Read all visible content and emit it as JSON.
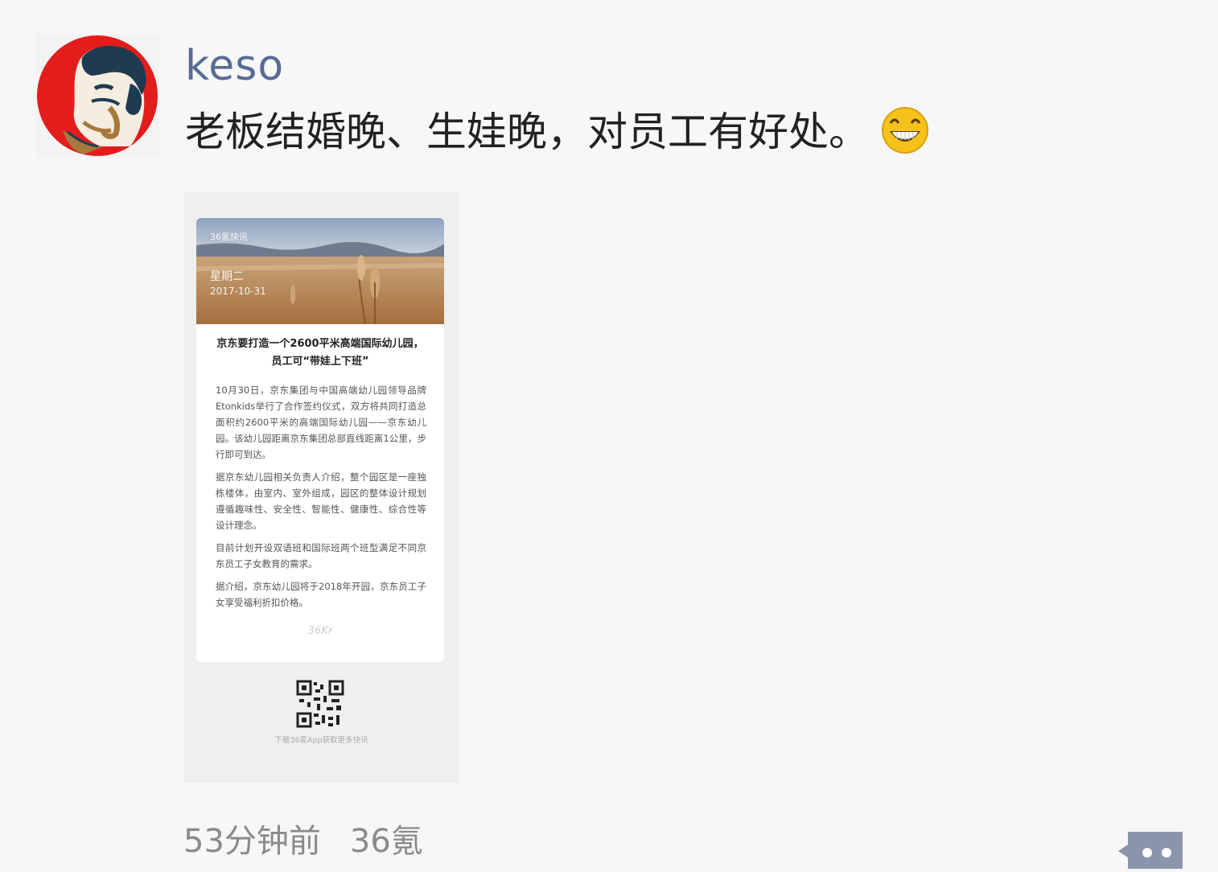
{
  "post": {
    "author": "keso",
    "text": "老板结婚晚、生娃晚，对员工有好处。",
    "emoji": "grinning-face-emoji"
  },
  "shared_image": {
    "brand": "36氪快讯",
    "weekday": "星期二",
    "date": "2017-10-31",
    "headline": "京东要打造一个2600平米高端国际幼儿园，员工可“带娃上下班”",
    "paragraphs": [
      "10月30日，京东集团与中国高端幼儿园领导品牌Etonkids举行了合作签约仪式，双方将共同打造总面积约2600平米的高端国际幼儿园——京东幼儿园。该幼儿园距离京东集团总部直线距离1公里，步行即可到达。",
      "据京东幼儿园相关负责人介绍，整个园区是一座独栋楼体，由室内、室外组成，园区的整体设计规划遵循趣味性、安全性、智能性、健康性、综合性等设计理念。",
      "目前计划开设双语班和国际班两个班型满足不同京东员工子女教育的需求。",
      "据介绍，京东幼儿园将于2018年开园，京东员工子女享受福利折扣价格。"
    ],
    "logo": "36Kr",
    "qr_caption": "下载36氪App获取更多快讯"
  },
  "meta": {
    "time": "53分钟前",
    "source": "36氪"
  },
  "colors": {
    "author": "#576b95",
    "text": "#222222",
    "meta": "#8a8a8a",
    "comment_button": "#8a95ac"
  }
}
